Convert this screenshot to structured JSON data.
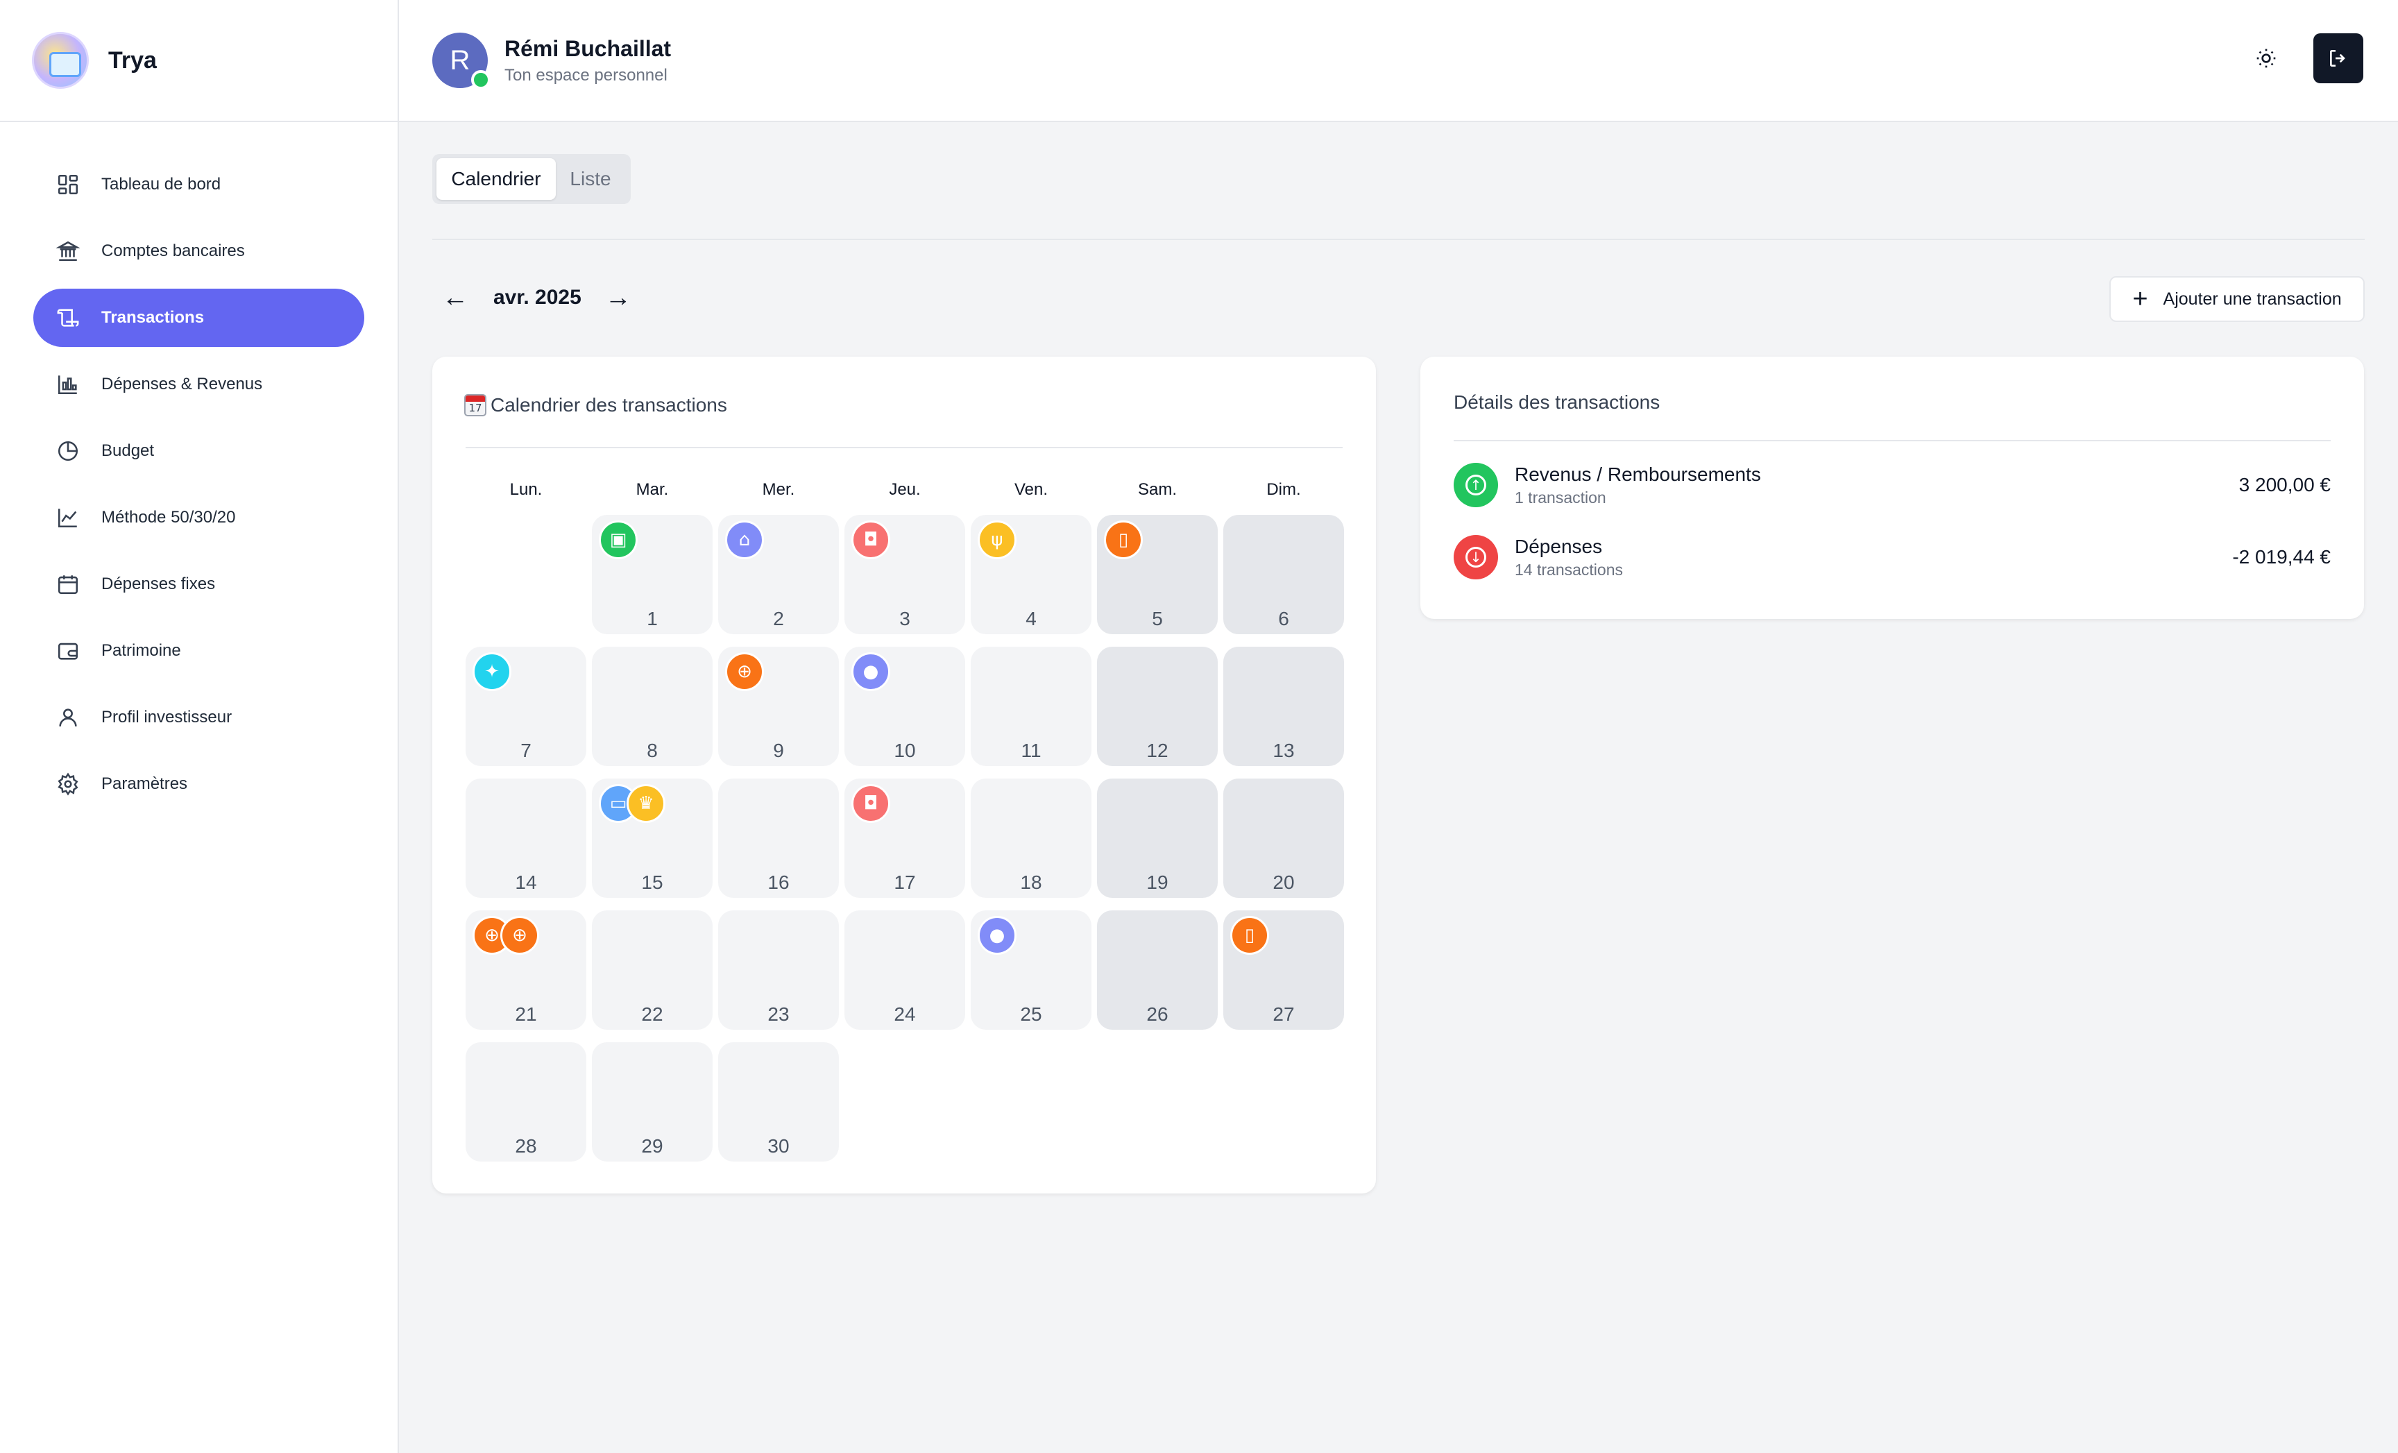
{
  "app": {
    "name": "Trya"
  },
  "colors": {
    "accent": "#6366f1",
    "income": "#22c55e",
    "expense": "#ef4444"
  },
  "sidebar": {
    "items": [
      {
        "label": "Tableau de bord",
        "icon": "dashboard-icon"
      },
      {
        "label": "Comptes bancaires",
        "icon": "bank-icon"
      },
      {
        "label": "Transactions",
        "icon": "receipt-icon",
        "active": true
      },
      {
        "label": "Dépenses & Revenus",
        "icon": "bar-chart-icon"
      },
      {
        "label": "Budget",
        "icon": "pie-chart-icon"
      },
      {
        "label": "Méthode 50/30/20",
        "icon": "line-chart-icon"
      },
      {
        "label": "Dépenses fixes",
        "icon": "calendar-icon"
      },
      {
        "label": "Patrimoine",
        "icon": "wallet-icon"
      },
      {
        "label": "Profil investisseur",
        "icon": "user-icon"
      },
      {
        "label": "Paramètres",
        "icon": "gear-icon"
      }
    ]
  },
  "header": {
    "avatar_initial": "R",
    "user_name": "Rémi Buchaillat",
    "subtitle": "Ton espace personnel"
  },
  "view_toggle": {
    "calendar": "Calendrier",
    "list": "Liste"
  },
  "month_nav": {
    "prev": "←",
    "label": "avr. 2025",
    "next": "→"
  },
  "add_button": {
    "label": "Ajouter une transaction"
  },
  "calendar": {
    "title": "Calendrier des transactions",
    "emoji_day": "17",
    "weekdays": [
      "Lun.",
      "Mar.",
      "Mer.",
      "Jeu.",
      "Ven.",
      "Sam.",
      "Dim."
    ],
    "days": [
      {
        "day": "1",
        "icons": [
          {
            "name": "wallet-icon",
            "color": "#22c55e",
            "glyph": "▣"
          }
        ]
      },
      {
        "day": "2",
        "icons": [
          {
            "name": "home-icon",
            "color": "#818cf8",
            "glyph": "⌂"
          }
        ]
      },
      {
        "day": "3",
        "icons": [
          {
            "name": "shopping-bag-icon",
            "color": "#f87171",
            "glyph": "◘"
          }
        ]
      },
      {
        "day": "4",
        "icons": [
          {
            "name": "utensils-icon",
            "color": "#fbbf24",
            "glyph": "ψ"
          }
        ]
      },
      {
        "day": "5",
        "icons": [
          {
            "name": "smartphone-icon",
            "color": "#f97316",
            "glyph": "▯"
          }
        ]
      },
      {
        "day": "6",
        "icons": []
      },
      {
        "day": "7",
        "icons": [
          {
            "name": "handshake-icon",
            "color": "#22d3ee",
            "glyph": "✦"
          }
        ]
      },
      {
        "day": "8",
        "icons": []
      },
      {
        "day": "9",
        "icons": [
          {
            "name": "globe-icon",
            "color": "#f97316",
            "glyph": "⊕"
          }
        ]
      },
      {
        "day": "10",
        "icons": [
          {
            "name": "piggy-bank-icon",
            "color": "#818cf8",
            "glyph": "●"
          }
        ]
      },
      {
        "day": "11",
        "icons": []
      },
      {
        "day": "12",
        "icons": []
      },
      {
        "day": "13",
        "icons": []
      },
      {
        "day": "14",
        "icons": []
      },
      {
        "day": "15",
        "icons": [
          {
            "name": "car-icon",
            "color": "#60a5fa",
            "glyph": "▭"
          },
          {
            "name": "chef-hat-icon",
            "color": "#fbbf24",
            "glyph": "♛"
          }
        ]
      },
      {
        "day": "16",
        "icons": []
      },
      {
        "day": "17",
        "icons": [
          {
            "name": "shopping-bag-icon",
            "color": "#f87171",
            "glyph": "◘"
          }
        ]
      },
      {
        "day": "18",
        "icons": []
      },
      {
        "day": "19",
        "icons": []
      },
      {
        "day": "20",
        "icons": []
      },
      {
        "day": "21",
        "icons": [
          {
            "name": "globe-icon",
            "color": "#f97316",
            "glyph": "⊕"
          },
          {
            "name": "globe-icon",
            "color": "#f97316",
            "glyph": "⊕"
          }
        ]
      },
      {
        "day": "22",
        "icons": []
      },
      {
        "day": "23",
        "icons": []
      },
      {
        "day": "24",
        "icons": []
      },
      {
        "day": "25",
        "icons": [
          {
            "name": "piggy-bank-icon",
            "color": "#818cf8",
            "glyph": "●"
          }
        ]
      },
      {
        "day": "26",
        "icons": []
      },
      {
        "day": "27",
        "icons": [
          {
            "name": "smartphone-icon",
            "color": "#f97316",
            "glyph": "▯"
          }
        ]
      },
      {
        "day": "28",
        "icons": []
      },
      {
        "day": "29",
        "icons": []
      },
      {
        "day": "30",
        "icons": []
      }
    ]
  },
  "details": {
    "title": "Détails des transactions",
    "rows": [
      {
        "label": "Revenus / Remboursements",
        "count": "1 transaction",
        "amount": "3 200,00 €",
        "icon": "arrow-up-circle-icon",
        "glyph": "↑",
        "color": "#22c55e"
      },
      {
        "label": "Dépenses",
        "count": "14 transactions",
        "amount": "-2 019,44 €",
        "icon": "arrow-down-circle-icon",
        "glyph": "↓",
        "color": "#ef4444"
      }
    ]
  }
}
